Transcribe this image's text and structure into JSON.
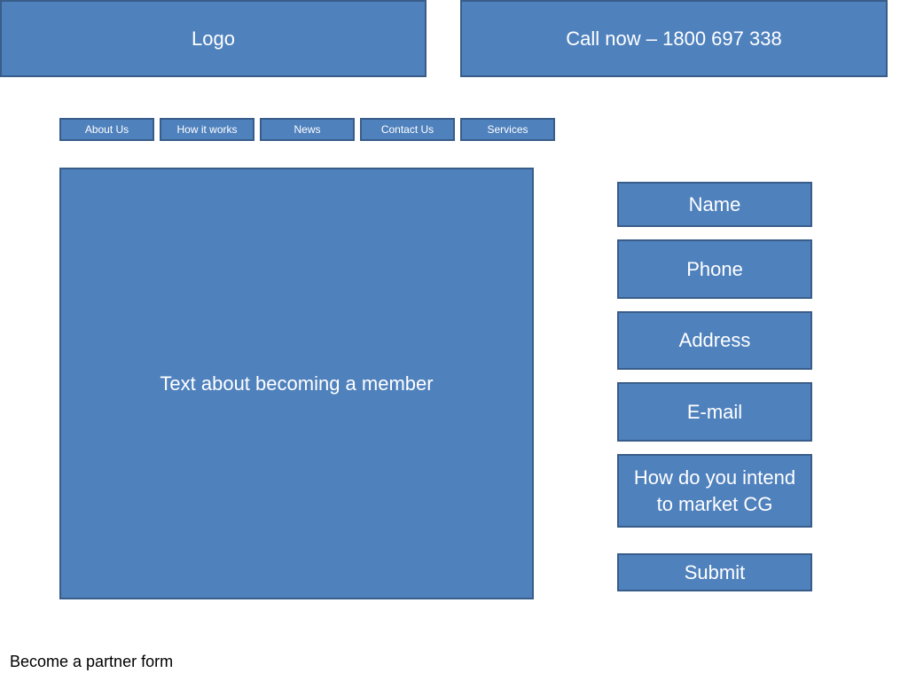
{
  "header": {
    "logo_label": "Logo",
    "call_label": "Call now – 1800 697 338"
  },
  "nav": {
    "items": [
      {
        "label": "About Us"
      },
      {
        "label": "How it works"
      },
      {
        "label": "News"
      },
      {
        "label": "Contact Us"
      },
      {
        "label": "Services"
      }
    ]
  },
  "main": {
    "content_text": "Text about becoming a member"
  },
  "form": {
    "name_label": "Name",
    "phone_label": "Phone",
    "address_label": "Address",
    "email_label": "E-mail",
    "market_label": "How do you intend to market CG",
    "submit_label": "Submit"
  },
  "caption": "Become a partner form",
  "colors": {
    "box_fill": "#4f81bd",
    "box_border": "#385d8a",
    "box_text": "#ffffff"
  }
}
